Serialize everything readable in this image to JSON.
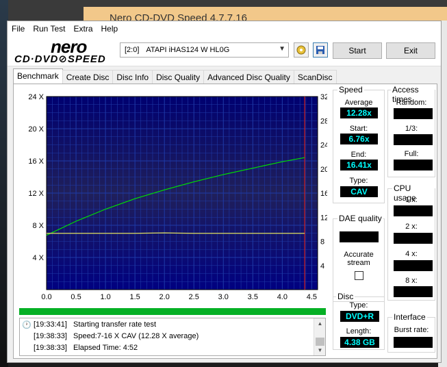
{
  "window": {
    "title": "Nero CD-DVD Speed 4.7.7.16"
  },
  "menu": [
    "File",
    "Run Test",
    "Extra",
    "Help"
  ],
  "logo": {
    "brand": "nero",
    "sub": "CD·DVD⊘SPEED"
  },
  "toolbar": {
    "drive_address": "[2:0]",
    "drive_name": "ATAPI iHAS124   W HL0G",
    "start_label": "Start",
    "exit_label": "Exit"
  },
  "tabs": [
    "Benchmark",
    "Create Disc",
    "Disc Info",
    "Disc Quality",
    "Advanced Disc Quality",
    "ScanDisc"
  ],
  "chart_data": {
    "type": "line",
    "y_left_ticks": [
      "24 X",
      "20 X",
      "16 X",
      "12 X",
      "8 X",
      "4 X"
    ],
    "y_right_ticks": [
      "32",
      "28",
      "24",
      "20",
      "16",
      "12",
      "8",
      "4"
    ],
    "x_ticks": [
      "0.0",
      "0.5",
      "1.0",
      "1.5",
      "2.0",
      "2.5",
      "3.0",
      "3.5",
      "4.0",
      "4.5"
    ],
    "xlim": [
      0,
      4.6
    ],
    "ylim_left": [
      0,
      24
    ],
    "ylim_right": [
      0,
      32
    ],
    "marker_x": 4.38,
    "series": [
      {
        "color": "#00e000",
        "x": [
          0.0,
          0.5,
          1.0,
          1.5,
          2.0,
          2.5,
          3.0,
          3.5,
          4.0,
          4.38
        ],
        "y": [
          6.76,
          8.5,
          10.0,
          11.3,
          12.4,
          13.4,
          14.3,
          15.1,
          15.9,
          16.41
        ]
      },
      {
        "color": "#e0e060",
        "x": [
          0.0,
          0.5,
          1.0,
          1.5,
          2.0,
          2.5,
          3.0,
          3.5,
          4.0,
          4.38
        ],
        "y": [
          7.0,
          7.0,
          7.0,
          7.0,
          7.05,
          7.0,
          7.0,
          7.0,
          7.0,
          7.0
        ]
      }
    ]
  },
  "log": [
    {
      "time": "[19:33:41]",
      "msg": "Starting transfer rate test"
    },
    {
      "time": "[19:38:33]",
      "msg": "Speed:7-16 X CAV (12.28 X average)"
    },
    {
      "time": "[19:38:33]",
      "msg": "Elapsed Time:  4:52"
    }
  ],
  "speed": {
    "title": "Speed",
    "average_label": "Average",
    "average": "12.28x",
    "start_label": "Start:",
    "start": "6.76x",
    "end_label": "End:",
    "end": "16.41x",
    "type_label": "Type:",
    "type": "CAV"
  },
  "access_times": {
    "title": "Access times",
    "random_label": "Random:",
    "third_label": "1/3:",
    "full_label": "Full:"
  },
  "cpu_usage": {
    "title": "CPU usage",
    "labels": [
      "1 x:",
      "2 x:",
      "4 x:",
      "8 x:"
    ]
  },
  "dae": {
    "title": "DAE quality",
    "accurate_label": "Accurate stream"
  },
  "disc": {
    "title": "Disc",
    "type_label": "Type:",
    "type": "DVD+R",
    "length_label": "Length:",
    "length": "4.38 GB"
  },
  "interface": {
    "title": "Interface",
    "burst_label": "Burst rate:"
  }
}
